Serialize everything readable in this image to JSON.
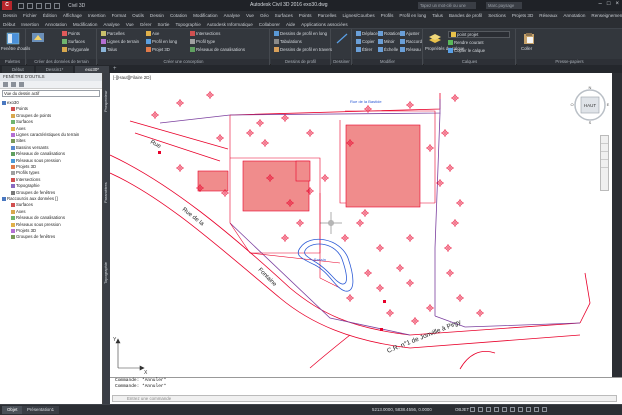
{
  "titlebar": {
    "logo": "C",
    "file_menu": "Civil 3D",
    "title": "Autodesk Civil 3D 2016   exo30.dwg",
    "search_placeholder": "Tapez un mot-clé ou une expression",
    "user": "Marc.paysage"
  },
  "ribbon_tabs_row1": [
    "Dessin",
    "Fichier",
    "Édition",
    "Affichage",
    "Insertion",
    "Format",
    "Outils",
    "Dessin",
    "Cotation",
    "Modification",
    "Analyse",
    "Vue",
    "Géo",
    "Surfaces",
    "Points",
    "Parcelles",
    "Lignes/Courbes",
    "Profils",
    "Profil en long",
    "Talus",
    "Bandes de profil",
    "Sections",
    "Projets 3D",
    "Réseaux",
    "Annotation",
    "Renseignements",
    "Fenêtre"
  ],
  "ribbon_tabs_row2": [
    "Début",
    "Insertion",
    "Annotation",
    "Modification",
    "Analyse",
    "Vue",
    "Gérer",
    "Sortie",
    "Topographie",
    "Autodesk Informatique",
    "Collaborer",
    "Aide",
    "Applications associées"
  ],
  "ribbon": {
    "groups": [
      {
        "label": "Palettes",
        "buttons": [
          "Fenêtre d'outils"
        ]
      },
      {
        "label": "Créer des données de terrain",
        "buttons": [
          "Points",
          "Surfaces",
          "Polygonale",
          "Parcelles",
          "Lignes de terrain",
          "Talus"
        ]
      },
      {
        "label": "Créer une conception",
        "buttons": [
          "Axe",
          "Profil en long",
          "Projet 3D",
          "Intersections",
          "Profil type",
          "Réseaux de canalisations"
        ]
      },
      {
        "label": "Dessins de profil",
        "buttons": [
          "Dessins de profil en long",
          "Tabulations",
          "Dessins de profil en travers"
        ]
      },
      {
        "label": "Dessiner",
        "buttons": [
          "Ligne",
          "Arc",
          "Polyligne"
        ]
      },
      {
        "label": "Modifier",
        "buttons": [
          "Déplacer",
          "Copier",
          "Étirer",
          "Rotation",
          "Miroir",
          "Échelle",
          "Ajuster",
          "Raccord",
          "Réseau"
        ]
      },
      {
        "label": "Calques",
        "buttons": [
          "Propriétés du calque",
          "Rendre courant",
          "Copier le calque"
        ]
      },
      {
        "label": "Presse-papiers",
        "buttons": [
          "Coller"
        ]
      }
    ],
    "layer_combo": "point projet"
  },
  "doctabs": [
    "Début",
    "Dessin1*",
    "exo30*"
  ],
  "toolspace": {
    "title": "FENÊTRE D'OUTILS",
    "combo": "Vue du dessin actif",
    "tree": [
      {
        "label": "exo30",
        "level": 0,
        "icon": "drawing-icon"
      },
      {
        "label": "Points",
        "level": 1,
        "icon": "points-icon"
      },
      {
        "label": "Groupes de points",
        "level": 1,
        "icon": "point-groups-icon"
      },
      {
        "label": "Surfaces",
        "level": 1,
        "icon": "surfaces-icon"
      },
      {
        "label": "Axes",
        "level": 1,
        "icon": "alignments-icon"
      },
      {
        "label": "Lignes caractéristiques du terrain",
        "level": 1,
        "icon": "featureline-icon"
      },
      {
        "label": "Sites",
        "level": 1,
        "icon": "sites-icon"
      },
      {
        "label": "Bassins versants",
        "level": 1,
        "icon": "catchment-icon"
      },
      {
        "label": "Réseaux de canalisations",
        "level": 1,
        "icon": "pipe-network-icon"
      },
      {
        "label": "Réseaux sous pression",
        "level": 1,
        "icon": "pressure-network-icon"
      },
      {
        "label": "Projets 3D",
        "level": 1,
        "icon": "corridor-icon"
      },
      {
        "label": "Profils types",
        "level": 1,
        "icon": "assembly-icon"
      },
      {
        "label": "Intersections",
        "level": 1,
        "icon": "intersection-icon"
      },
      {
        "label": "Topographie",
        "level": 1,
        "icon": "survey-icon"
      },
      {
        "label": "Groupes de fenêtres",
        "level": 1,
        "icon": "view-frame-icon"
      },
      {
        "label": "Raccourcis aux données []",
        "level": 0,
        "icon": "data-shortcut-icon"
      },
      {
        "label": "Surfaces",
        "level": 1,
        "icon": "surfaces-icon"
      },
      {
        "label": "Axes",
        "level": 1,
        "icon": "alignments-icon"
      },
      {
        "label": "Réseaux de canalisations",
        "level": 1,
        "icon": "pipe-network-icon"
      },
      {
        "label": "Réseaux sous pression",
        "level": 1,
        "icon": "pressure-network-icon"
      },
      {
        "label": "Projets 3D",
        "level": 1,
        "icon": "corridor-icon"
      },
      {
        "label": "Groupes de fenêtres",
        "level": 1,
        "icon": "view-frame-icon"
      }
    ],
    "vtabs": [
      "Prospecteur",
      "Paramètres",
      "Topographie"
    ]
  },
  "drawing": {
    "viewport_label": "[-][Haut][Filaire 2D]",
    "labels": {
      "rue1": "Rue",
      "rue2": "Rue de la",
      "fontaine": "Fontaine",
      "cr": "C.R. n°1 de Jonville à Pirgy",
      "bassin": "Bassin",
      "top_road": "Rue de la Bastide"
    },
    "viewcube_label": "HAUT",
    "viewcube_n": "N",
    "viewcube_s": "S",
    "viewcube_e": "E",
    "viewcube_w": "O",
    "ucs_y": "Y",
    "ucs_x": "X"
  },
  "command": {
    "line1": "Commande: *Annuler*",
    "line2": "Commande: *Annuler*",
    "placeholder": "Entrez une commande"
  },
  "statusbar": {
    "layout_tabs": [
      "Objet",
      "Présentation1"
    ],
    "coords": "5213.0000, 5838.4556, 0.0000",
    "mode": "OBJET"
  },
  "colors": {
    "drawing_red": "#e8002a",
    "building_fill": "#f08c8c",
    "blue": "#2d5bd6",
    "purple": "#7b3f9e"
  }
}
